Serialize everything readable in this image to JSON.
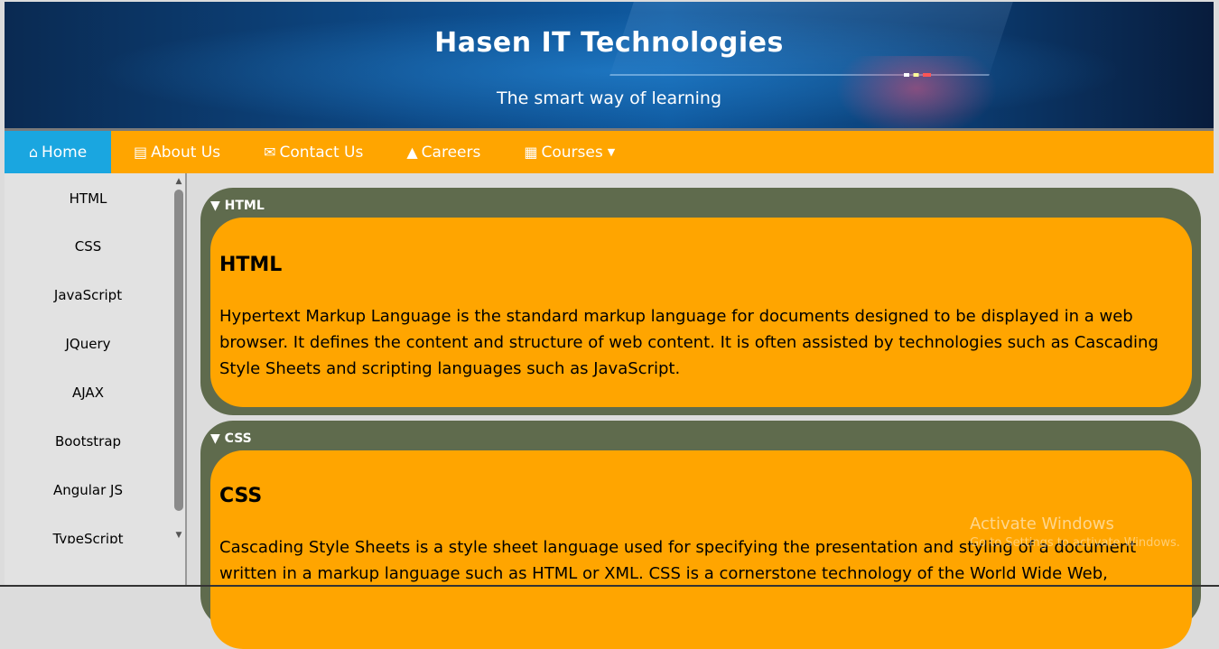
{
  "header": {
    "title": "Hasen IT Technologies",
    "tagline": "The smart way of learning"
  },
  "nav": {
    "items": [
      {
        "label": "Home",
        "icon": "home-icon",
        "active": true
      },
      {
        "label": "About Us",
        "icon": "id-card-icon"
      },
      {
        "label": "Contact Us",
        "icon": "envelope-icon"
      },
      {
        "label": "Careers",
        "icon": "graduation-cap-icon"
      },
      {
        "label": "Courses",
        "icon": "book-icon",
        "dropdown_icon": "caret-down-icon"
      }
    ]
  },
  "sidebar": {
    "items": [
      "HTML",
      "CSS",
      "JavaScript",
      "JQuery",
      "AJAX",
      "Bootstrap",
      "Angular JS",
      "TypeScript"
    ]
  },
  "sections": [
    {
      "summary": "HTML",
      "heading": "HTML",
      "text": "Hypertext Markup Language is the standard markup language for documents designed to be displayed in a web browser. It defines the content and structure of web content. It is often assisted by technologies such as Cascading Style Sheets and scripting languages such as JavaScript."
    },
    {
      "summary": "CSS",
      "heading": "CSS",
      "text": "Cascading Style Sheets is a style sheet language used for specifying the presentation and styling of a document written in a markup language such as HTML or XML. CSS is a cornerstone technology of the World Wide Web,"
    }
  ],
  "watermark": {
    "title": "Activate Windows",
    "subtitle": "Go to Settings to activate Windows."
  },
  "colors": {
    "nav_bg": "#ffa500",
    "nav_active": "#1aa6e0",
    "section_bg": "#5f6b4d",
    "panel_bg": "#ffa500"
  }
}
